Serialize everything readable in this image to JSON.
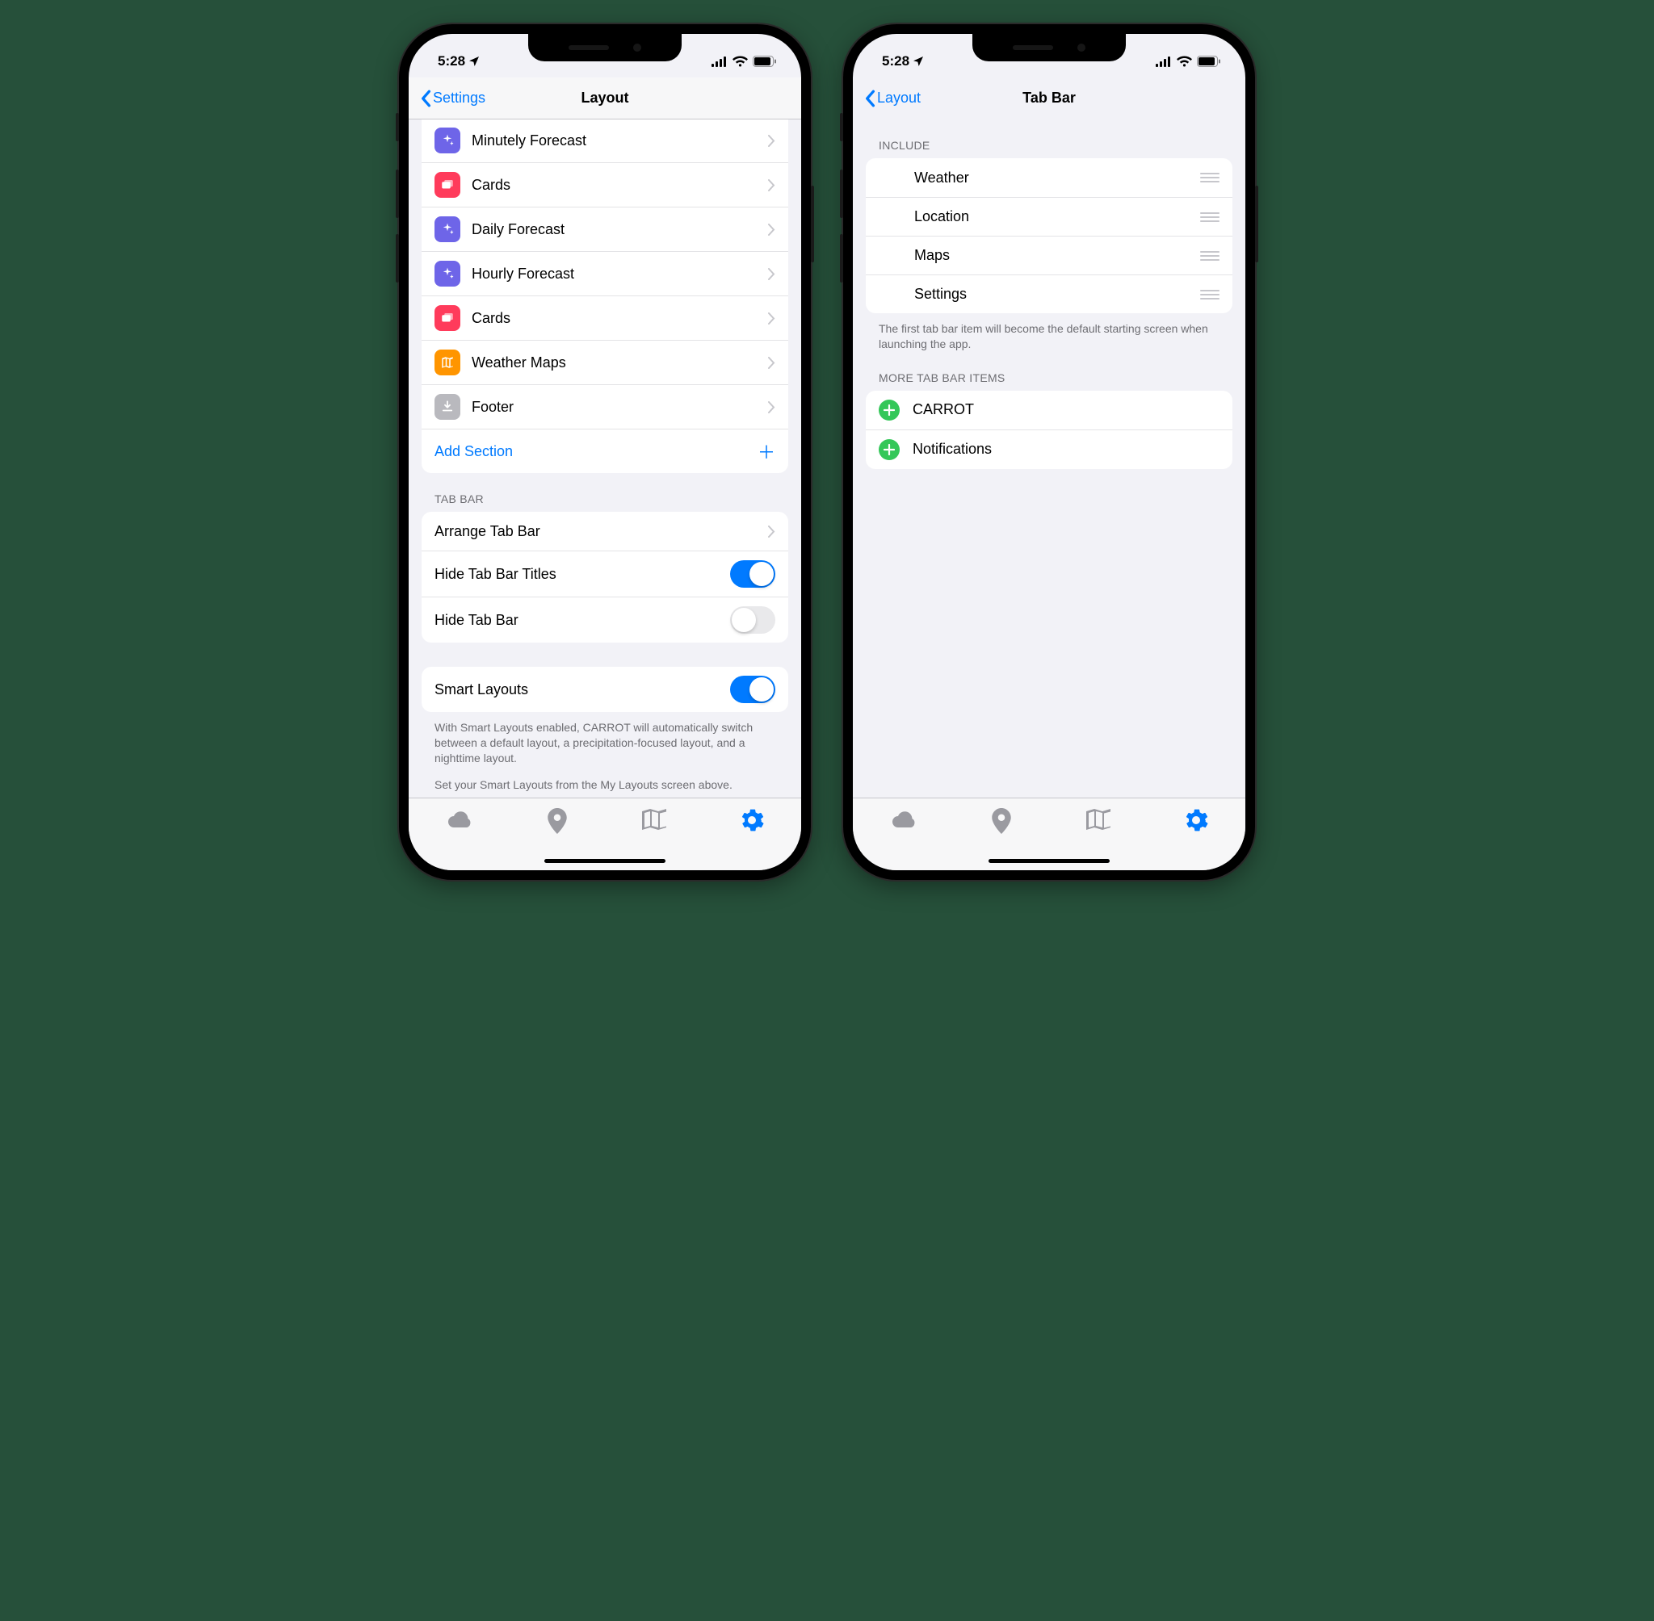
{
  "status": {
    "time": "5:28"
  },
  "left": {
    "nav": {
      "back": "Settings",
      "title": "Layout"
    },
    "layoutRows": [
      {
        "label": "Minutely Forecast",
        "iconColor": "purple",
        "icon": "sparkle"
      },
      {
        "label": "Cards",
        "iconColor": "red",
        "icon": "cards"
      },
      {
        "label": "Daily Forecast",
        "iconColor": "purple",
        "icon": "sparkle"
      },
      {
        "label": "Hourly Forecast",
        "iconColor": "purple",
        "icon": "sparkle"
      },
      {
        "label": "Cards",
        "iconColor": "red",
        "icon": "cards"
      },
      {
        "label": "Weather Maps",
        "iconColor": "orange",
        "icon": "map"
      },
      {
        "label": "Footer",
        "iconColor": "gray",
        "icon": "download"
      }
    ],
    "addSection": "Add Section",
    "tabBarHeader": "TAB BAR",
    "tabBarRows": {
      "arrange": "Arrange Tab Bar",
      "hideTitles": {
        "label": "Hide Tab Bar Titles",
        "on": true
      },
      "hideBar": {
        "label": "Hide Tab Bar",
        "on": false
      }
    },
    "smartLayouts": {
      "label": "Smart Layouts",
      "on": true
    },
    "footer1": "With Smart Layouts enabled, CARROT will automatically switch between a default layout, a precipitation-focused layout, and a nighttime layout.",
    "footer2": "Set your Smart Layouts from the My Layouts screen above."
  },
  "right": {
    "nav": {
      "back": "Layout",
      "title": "Tab Bar"
    },
    "includeHeader": "INCLUDE",
    "includeItems": [
      "Weather",
      "Location",
      "Maps",
      "Settings"
    ],
    "includeFooter": "The first tab bar item will become the default starting screen when launching the app.",
    "moreHeader": "MORE TAB BAR ITEMS",
    "moreItems": [
      "CARROT",
      "Notifications"
    ]
  }
}
